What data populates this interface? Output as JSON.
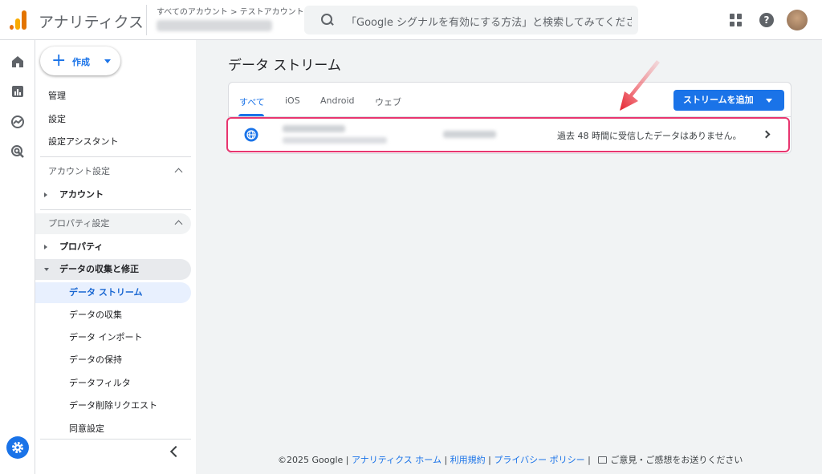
{
  "header": {
    "app_title": "アナリティクス",
    "breadcrumb": "すべてのアカウント > テストアカウント",
    "search_placeholder": "「Google シグナルを有効にする方法」と検索してみてくださ..."
  },
  "sidebar": {
    "create_label": "作成",
    "top_items": [
      "管理",
      "設定",
      "設定アシスタント"
    ],
    "account_section": "アカウント設定",
    "account_item": "アカウント",
    "property_section": "プロパティ設定",
    "property_item": "プロパティ",
    "data_group": "データの収集と修正",
    "data_items": [
      "データ ストリーム",
      "データの収集",
      "データ インポート",
      "データの保持",
      "データフィルタ",
      "データ削除リクエスト",
      "同意設定"
    ]
  },
  "main": {
    "title": "データ ストリーム",
    "tabs": [
      "すべて",
      "iOS",
      "Android",
      "ウェブ"
    ],
    "add_stream": "ストリームを追加",
    "stream_status": "過去 48 時間に受信したデータはありません。"
  },
  "footer": {
    "copyright": "©2025 Google",
    "links": [
      "アナリティクス ホーム",
      "利用規約",
      "プライバシー ポリシー"
    ],
    "feedback": "ご意見・ご感想をお送りください"
  },
  "colors": {
    "accent": "#1a73e8",
    "highlight": "#e8356f",
    "arrow": "#e5212e"
  }
}
